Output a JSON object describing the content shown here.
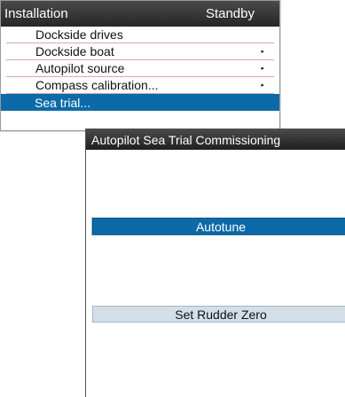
{
  "menu": {
    "title": "Installation",
    "status": "Standby",
    "items": [
      {
        "label": "Dockside drives",
        "has_submenu": false,
        "selected": false
      },
      {
        "label": "Dockside boat",
        "has_submenu": true,
        "selected": false
      },
      {
        "label": "Autopilot source",
        "has_submenu": true,
        "selected": false
      },
      {
        "label": "Compass calibration...",
        "has_submenu": true,
        "selected": false
      },
      {
        "label": "Sea trial...",
        "has_submenu": false,
        "selected": true
      }
    ],
    "submenu_arrow": "▸"
  },
  "dialog": {
    "title": "Autopilot Sea Trial Commissioning",
    "buttons": {
      "autotune_label": "Autotune",
      "rudder_zero_label": "Set Rudder Zero"
    }
  },
  "colors": {
    "accent": "#0b6aa7",
    "header": "#2e2e2e",
    "button_secondary": "#d2dfe8"
  }
}
